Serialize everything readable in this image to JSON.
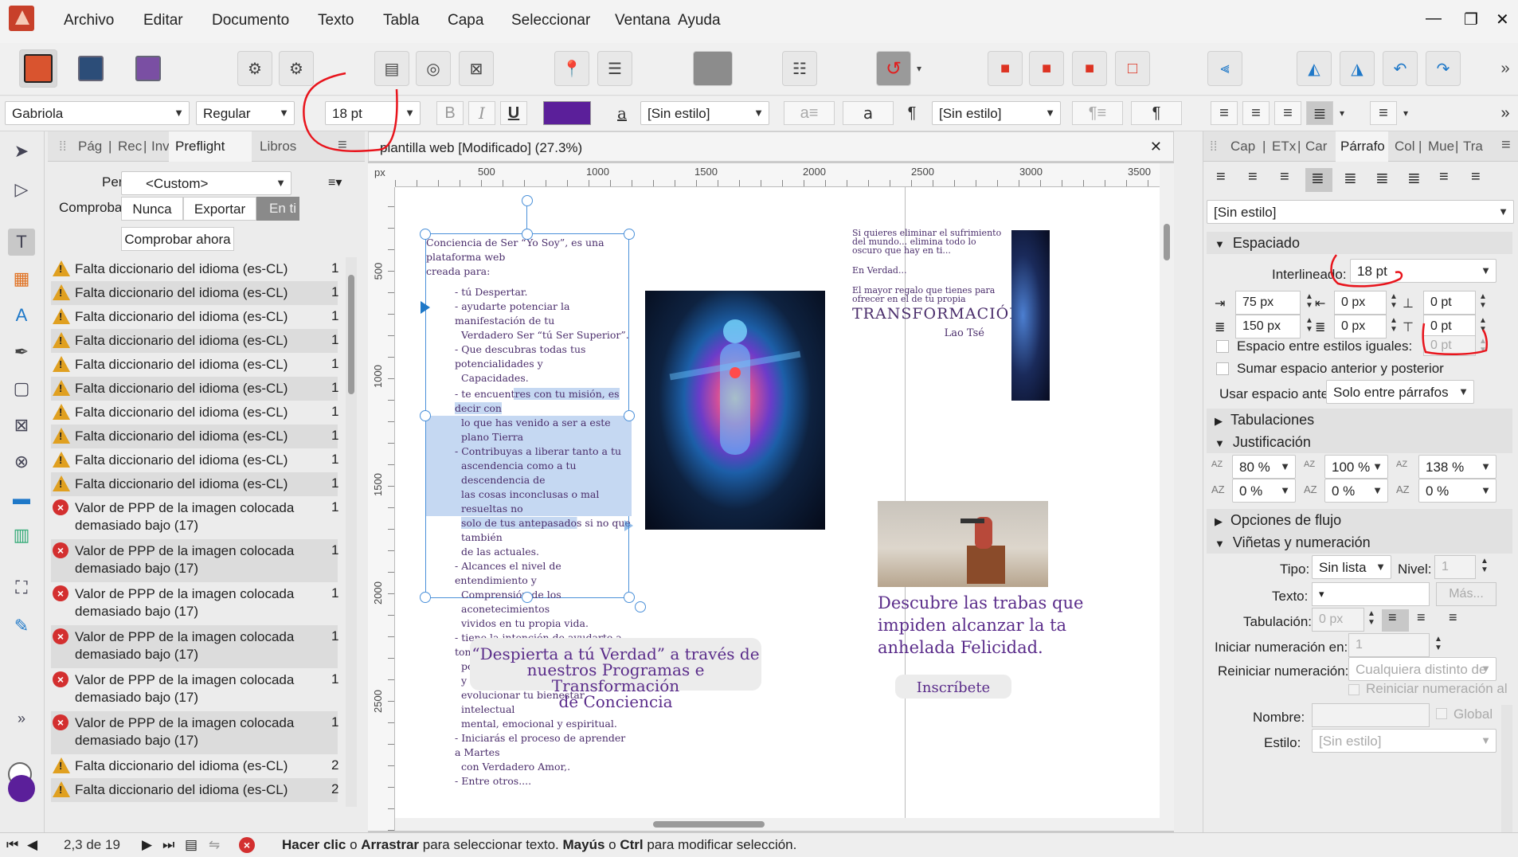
{
  "menu": [
    "Archivo",
    "Editar",
    "Documento",
    "Texto",
    "Tabla",
    "Capa",
    "Seleccionar",
    "Ventana",
    "Ayuda"
  ],
  "window_controls": [
    "—",
    "❐",
    "✕"
  ],
  "format_bar": {
    "font": "Gabriola",
    "style": "Regular",
    "size": "18 pt",
    "bold": "B",
    "italic": "I",
    "underline": "U",
    "color": "#5b1f9a",
    "char_style": "[Sin estilo]",
    "para_style": "[Sin estilo]"
  },
  "left_panel": {
    "tabs": [
      "Pág",
      "Rec",
      "Inv",
      "Preflight",
      "Libros"
    ],
    "active_tab": "Preflight",
    "profile_label": "Perfil:",
    "profile_value": "<Custom>",
    "check_label": "Comprobar:",
    "check_options": [
      "Nunca",
      "Exportar",
      "En ti"
    ],
    "check_now": "Comprobar ahora",
    "items": [
      {
        "type": "warn",
        "text": "Falta diccionario del idioma (es-CL)",
        "count": "1"
      },
      {
        "type": "warn",
        "text": "Falta diccionario del idioma (es-CL)",
        "count": "1"
      },
      {
        "type": "warn",
        "text": "Falta diccionario del idioma (es-CL)",
        "count": "1"
      },
      {
        "type": "warn",
        "text": "Falta diccionario del idioma (es-CL)",
        "count": "1"
      },
      {
        "type": "warn",
        "text": "Falta diccionario del idioma (es-CL)",
        "count": "1"
      },
      {
        "type": "warn",
        "text": "Falta diccionario del idioma (es-CL)",
        "count": "1"
      },
      {
        "type": "warn",
        "text": "Falta diccionario del idioma (es-CL)",
        "count": "1"
      },
      {
        "type": "warn",
        "text": "Falta diccionario del idioma (es-CL)",
        "count": "1"
      },
      {
        "type": "warn",
        "text": "Falta diccionario del idioma (es-CL)",
        "count": "1"
      },
      {
        "type": "warn",
        "text": "Falta diccionario del idioma (es-CL)",
        "count": "1"
      },
      {
        "type": "err",
        "text": "Valor de PPP de la imagen colocada",
        "text2": "demasiado bajo (17)",
        "count": "1"
      },
      {
        "type": "err",
        "text": "Valor de PPP de la imagen colocada",
        "text2": "demasiado bajo (17)",
        "count": "1"
      },
      {
        "type": "err",
        "text": "Valor de PPP de la imagen colocada",
        "text2": "demasiado bajo (17)",
        "count": "1"
      },
      {
        "type": "err",
        "text": "Valor de PPP de la imagen colocada",
        "text2": "demasiado bajo (17)",
        "count": "1"
      },
      {
        "type": "err",
        "text": "Valor de PPP de la imagen colocada",
        "text2": "demasiado bajo (17)",
        "count": "1"
      },
      {
        "type": "err",
        "text": "Valor de PPP de la imagen colocada",
        "text2": "demasiado bajo (17)",
        "count": "1"
      },
      {
        "type": "warn",
        "text": "Falta diccionario del idioma (es-CL)",
        "count": "2"
      },
      {
        "type": "warn",
        "text": "Falta diccionario del idioma (es-CL)",
        "count": "2"
      }
    ]
  },
  "document": {
    "title": "plantilla web [Modificado] (27.3%)",
    "ruler_h": [
      "500",
      "1000",
      "1500",
      "2000",
      "2500",
      "3000",
      "3500"
    ],
    "ruler_v": [
      "500",
      "1000",
      "1500",
      "2000",
      "2500"
    ],
    "ruler_unit": "px",
    "text_lines": [
      "Conciencia de Ser “Yo Soy”, es una plataforma web",
      "creada para:",
      "- tú Despertar.",
      "- ayudarte potenciar la manifestación de tu",
      "Verdadero Ser “tú Ser Superior”.",
      "- Que descubras todas tus potencialidades y",
      "Capacidades.",
      "- te encuentres con tu misión, es decir con",
      "lo que has venido a ser a este plano Tierra",
      "- Contribuyas a liberar tanto a tu",
      "ascendencia como a tu descendencia de",
      "las cosas inconclusas o mal resueltas no",
      "solo de tus antepasados si no que también",
      "de las actuales.",
      "- Alcances el nivel de entendimiento y",
      "Comprensión de los aconetecimientos",
      "vividos en tu propia vida.",
      "- tiene la intención de ayudarte a tomar tu",
      "poder personal para transformar y",
      "evolucionar tu bienestar intelectual",
      "mental, emocional y espiritual.",
      "- Iniciarás el proceso de aprender a Martes",
      "con Verdadero Amor,.",
      "- Entre otros...."
    ],
    "banner": [
      "“Despierta a tú Verdad” a través de",
      "nuestros Programas e Transformación",
      "de Conciencia"
    ],
    "quote": [
      "Si quieres eliminar el sufrimiento",
      "del mundo... elimina todo lo",
      "oscuro que hay en ti..."
    ],
    "quote2": "En Verdad...",
    "quote3": [
      "El mayor regalo que tienes para",
      "ofrecer en el de tu propia"
    ],
    "transform": "TRANSFORMACIÓN",
    "author": "Lao Tsé",
    "discover": [
      "Descubre las trabas que",
      "impiden alcanzar la ta",
      "anhelada Felicidad."
    ],
    "signup": "Inscríbete"
  },
  "right_panel": {
    "tabs": [
      "Cap",
      "ETx",
      "Car",
      "Párrafo",
      "Col",
      "Mue",
      "Tra"
    ],
    "active_tab": "Párrafo",
    "style": "[Sin estilo]",
    "spacing_header": "Espaciado",
    "leading_label": "Interlineado:",
    "leading": "18 pt",
    "indent_left": "75 px",
    "indent_first": "0 px",
    "space_before": "0 pt",
    "indent_right": "150 px",
    "indent_last": "0 px",
    "space_after": "0 pt",
    "same_style_label": "Espacio entre estilos iguales:",
    "same_style_value": "0 pt",
    "sum_label": "Sumar espacio anterior y posterior",
    "use_prev_label": "Usar espacio anterior:",
    "use_prev_value": "Solo entre párrafos",
    "tabs_header": "Tabulaciones",
    "justify_header": "Justificación",
    "justify_values": [
      "80 %",
      "100 %",
      "138 %",
      "0 %",
      "0 %",
      "0 %"
    ],
    "flow_header": "Opciones de flujo",
    "bullets_header": "Viñetas y numeración",
    "type_label": "Tipo:",
    "type_value": "Sin lista",
    "level_label": "Nivel:",
    "level_value": "1",
    "text_label": "Texto:",
    "more_label": "Más...",
    "tab_label": "Tabulación:",
    "tab_value": "0 px",
    "start_label": "Iniciar numeración en:",
    "start_value": "1",
    "restart_label": "Reiniciar numeración:",
    "restart_value": "Cualquiera distinto de",
    "restart_check": "Reiniciar numeración al",
    "name_label": "Nombre:",
    "global_label": "Global",
    "style_label": "Estilo:",
    "style_value": "[Sin estilo]"
  },
  "status": {
    "pages": "2,3 de 19",
    "hint_parts": [
      "Hacer clic",
      " o ",
      "Arrastrar",
      " para seleccionar texto. ",
      "Mayús",
      " o ",
      "Ctrl",
      " para modificar selección."
    ]
  }
}
